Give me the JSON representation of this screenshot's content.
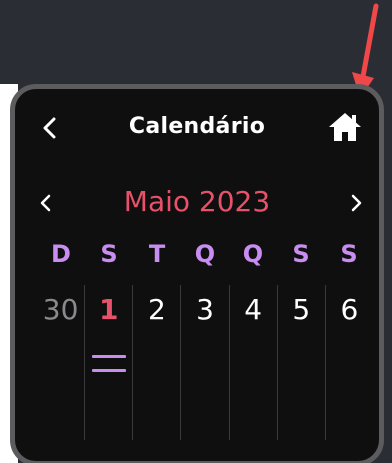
{
  "header": {
    "title": "Calendário",
    "back_icon": "chevron-left-icon",
    "home_icon": "home-icon"
  },
  "month": {
    "label": "Maio 2023",
    "prev_icon": "chevron-left-icon",
    "next_icon": "chevron-right-icon"
  },
  "weekdays": [
    "D",
    "S",
    "T",
    "Q",
    "Q",
    "S",
    "S"
  ],
  "days": [
    {
      "label": "30",
      "state": "outside-month"
    },
    {
      "label": "1",
      "state": "today",
      "events": 2
    },
    {
      "label": "2",
      "state": "normal"
    },
    {
      "label": "3",
      "state": "normal"
    },
    {
      "label": "4",
      "state": "normal"
    },
    {
      "label": "5",
      "state": "normal"
    },
    {
      "label": "6",
      "state": "normal"
    }
  ],
  "colors": {
    "accent": "#e8516a",
    "weekday": "#c78df0",
    "event_marker": "#c78df0",
    "background": "#0f0f10",
    "border": "#5c5c5e",
    "annotation_arrow": "#f04848"
  }
}
